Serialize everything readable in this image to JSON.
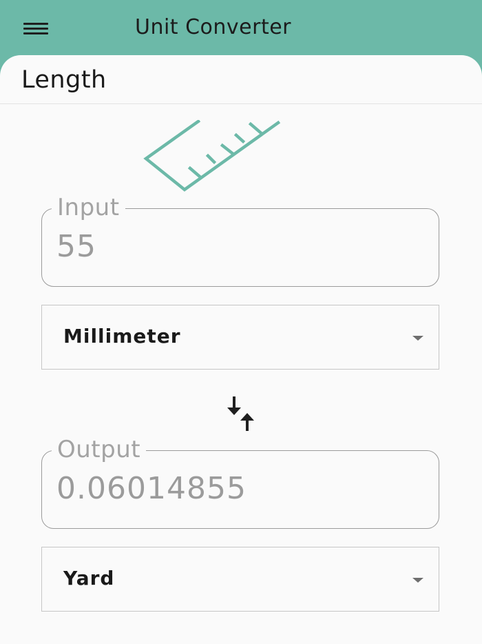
{
  "appbar": {
    "title": "Unit Converter",
    "menu_icon": "hamburger-menu-icon"
  },
  "section": {
    "title": "Length",
    "icon": "ruler-icon"
  },
  "input": {
    "label": "Input",
    "value": "55"
  },
  "from_unit": {
    "selected": "Millimeter"
  },
  "swap": {
    "icon": "swap-vertical-icon"
  },
  "output": {
    "label": "Output",
    "value": "0.06014855"
  },
  "to_unit": {
    "selected": "Yard"
  },
  "colors": {
    "accent": "#6cb9a8",
    "background": "#fafafa",
    "text": "#1a1a1a",
    "muted_text": "#9b9b9b"
  }
}
